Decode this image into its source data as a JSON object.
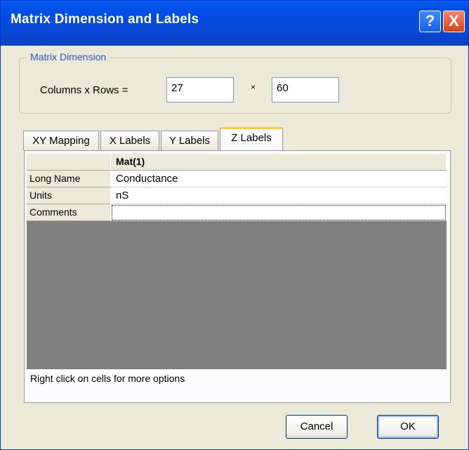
{
  "window": {
    "title": "Matrix Dimension and Labels",
    "help_glyph": "?",
    "close_glyph": "X"
  },
  "dimension": {
    "legend": "Matrix Dimension",
    "label": "Columns x Rows =",
    "columns": "27",
    "separator": "×",
    "rows": "60"
  },
  "tabs": [
    {
      "label": "XY Mapping",
      "active": false
    },
    {
      "label": "X Labels",
      "active": false
    },
    {
      "label": "Y Labels",
      "active": false
    },
    {
      "label": "Z Labels",
      "active": true
    }
  ],
  "grid": {
    "column_header": "Mat(1)",
    "rows": [
      {
        "label": "Long Name",
        "value": "Conductance"
      },
      {
        "label": "Units",
        "value": "nS"
      },
      {
        "label": "Comments",
        "value": ""
      }
    ]
  },
  "hint": "Right click on cells for more options",
  "buttons": {
    "cancel": "Cancel",
    "ok": "OK"
  },
  "colors": {
    "title_bar": "#0a5df0",
    "active_tab_accent": "#ffc83c",
    "grid_background": "#808080"
  }
}
